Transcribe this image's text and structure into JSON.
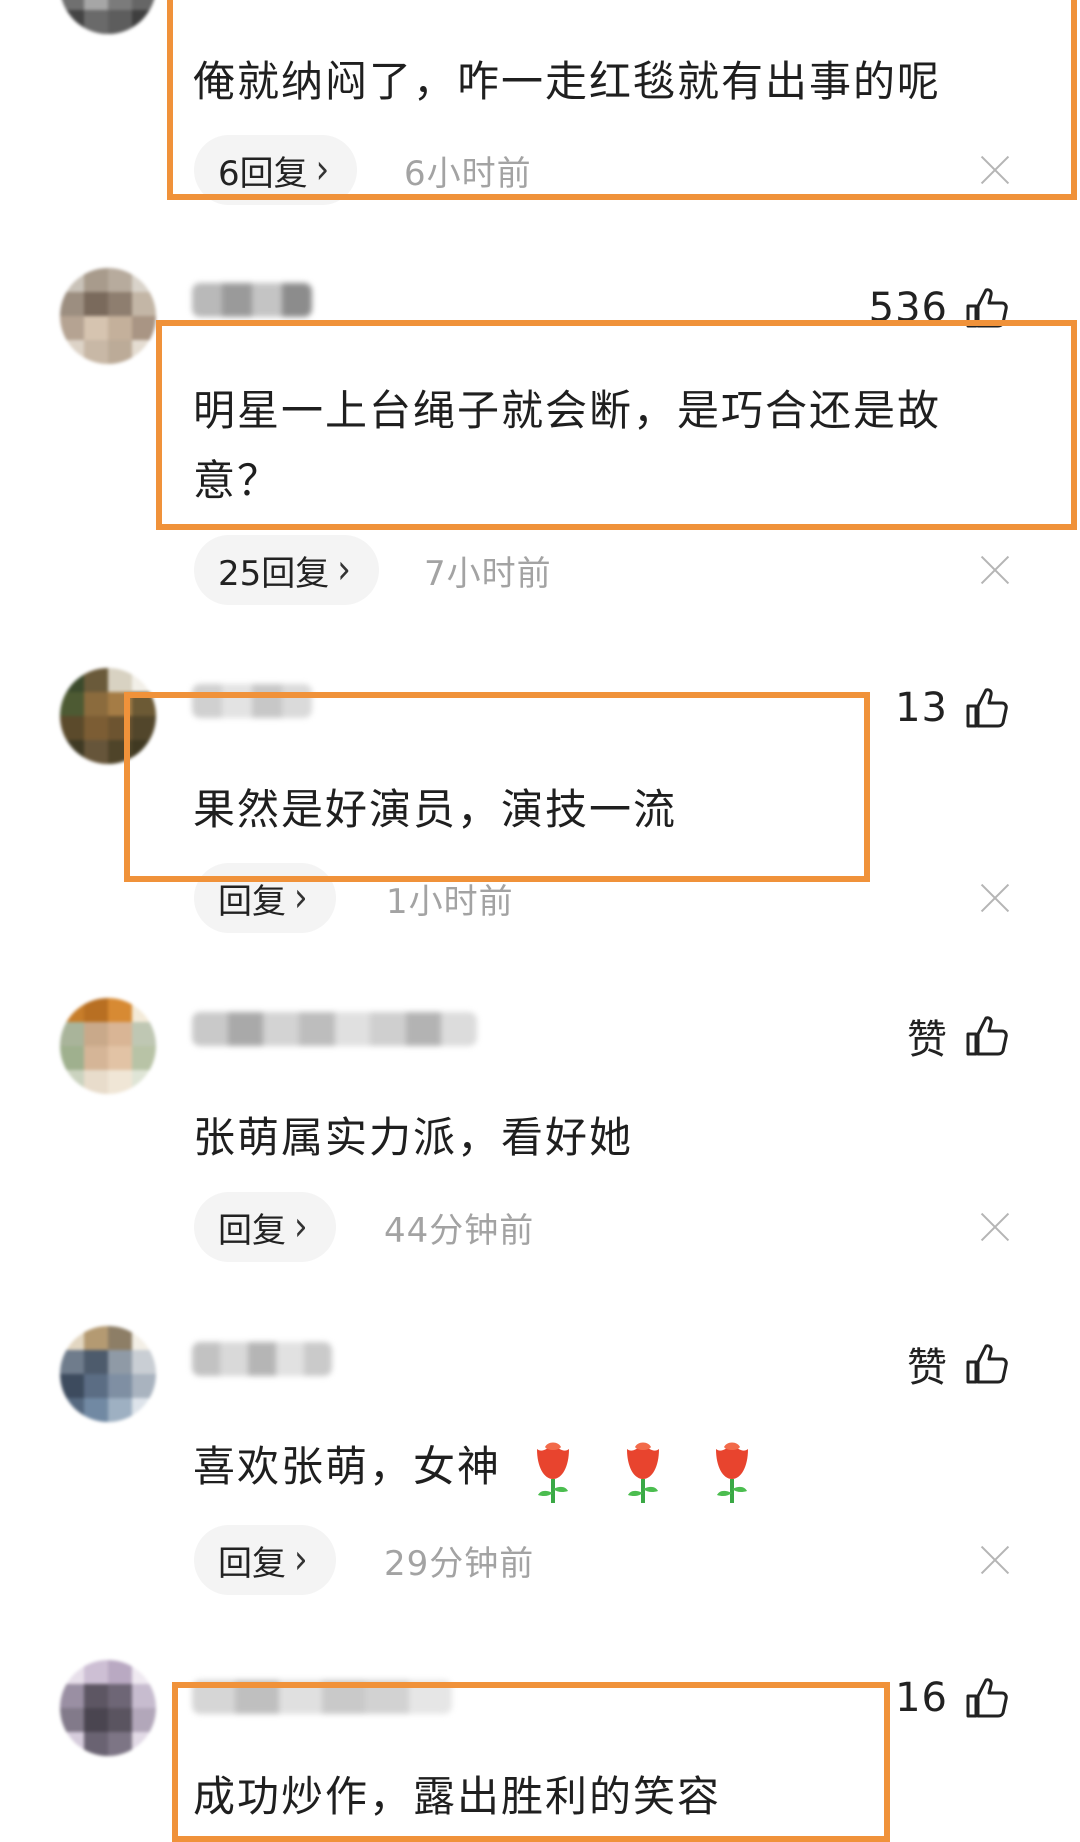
{
  "comments": [
    {
      "text": "俺就纳闷了，咋一走红毯就有出事的呢",
      "reply_label": "6回复",
      "time": "6小时前",
      "likes": ""
    },
    {
      "text": "明星一上台绳子就会断，是巧合还是故意？",
      "reply_label": "25回复",
      "time": "7小时前",
      "likes": "536"
    },
    {
      "text": "果然是好演员，演技一流",
      "reply_label": "回复",
      "time": "1小时前",
      "likes": "13"
    },
    {
      "text": "张萌属实力派，看好她",
      "reply_label": "回复",
      "time": "44分钟前",
      "likes": "赞"
    },
    {
      "text": "喜欢张萌，女神",
      "reply_label": "回复",
      "time": "29分钟前",
      "likes": "赞"
    },
    {
      "text": "成功炒作，露出胜利的笑容",
      "reply_label": "",
      "time": "",
      "likes": "16"
    }
  ],
  "icons": {
    "like": "thumbs-up-icon",
    "close": "close-icon",
    "chevron": "chevron-right-icon",
    "emoji": "rose-emoji"
  },
  "colors": {
    "highlight": "#f0923a",
    "reply_bg": "#f4f4f4",
    "time": "#a3a3a3"
  }
}
